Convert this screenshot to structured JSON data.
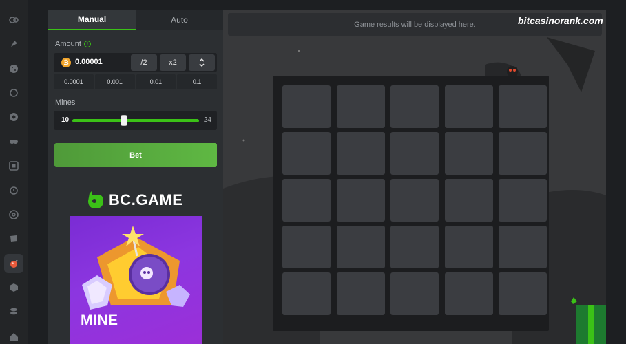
{
  "rail": {
    "icons": [
      "coins-icon",
      "rocket-icon",
      "dice-icon",
      "ball-icon",
      "target-icon",
      "ticket-icon",
      "slots-icon",
      "timer-icon",
      "roulette-icon",
      "cube-icon",
      "mine-icon",
      "box-icon",
      "coin-stack-icon",
      "home-icon"
    ]
  },
  "tabs": {
    "manual": "Manual",
    "auto": "Auto"
  },
  "amount": {
    "label": "Amount",
    "value": "0.00001",
    "coin_symbol": "₿",
    "half_label": "/2",
    "double_label": "x2",
    "quick": [
      "0.0001",
      "0.001",
      "0.01",
      "0.1"
    ]
  },
  "mines": {
    "label": "Mines",
    "min": "10",
    "max": "24",
    "slider_value": 0.41
  },
  "bet_label": "Bet",
  "brand": {
    "name": "BC.GAME"
  },
  "promo": {
    "title": "MINE"
  },
  "game": {
    "results_placeholder": "Game results will be displayed here.",
    "grid_rows": 5,
    "grid_cols": 5
  },
  "watermark": "bitcasinorank.com",
  "colors": {
    "accent": "#3bc117",
    "bet": "#5fb843",
    "coin": "#f2a52b",
    "promo": "#8c36e0"
  }
}
